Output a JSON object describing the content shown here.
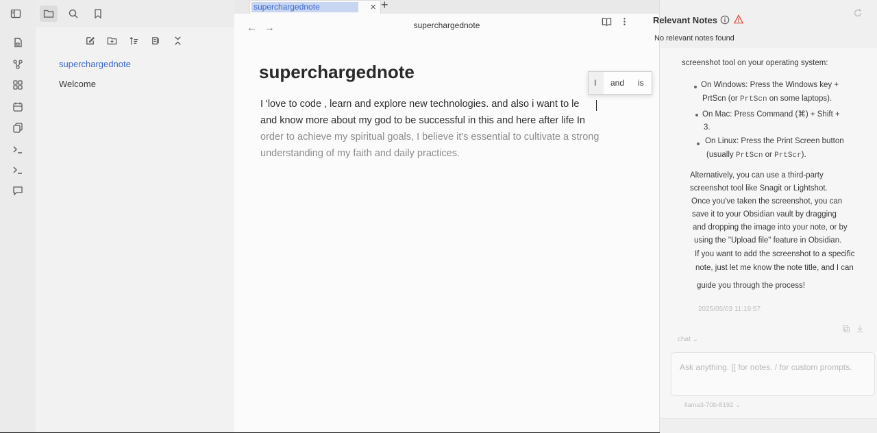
{
  "tab": {
    "title": "superchargednote",
    "close": "×",
    "new": "+"
  },
  "nav": {
    "back": "←",
    "forward": "→",
    "view_title": "superchargednote"
  },
  "files": [
    {
      "name": "superchargednote"
    },
    {
      "name": "Welcome"
    }
  ],
  "note": {
    "title": "superchargednote",
    "lines": [
      "I 'love to code , learn and explore new technologies.  and also i want to le",
      "and know more about my god to be successful in this and  here after life In",
      "order to achieve my spiritual goals, I believe it's essential to cultivate a strong",
      "understanding of my faith and daily practices."
    ]
  },
  "suggestions": [
    "I",
    "and",
    "is"
  ],
  "relevant": {
    "title": "Relevant Notes",
    "empty": "No relevant notes found"
  },
  "chat": {
    "intro": "screenshot tool on your operating system:",
    "b1a": "On Windows: Press the Windows key +",
    "b1b_pre": "PrtScn (or ",
    "b1b_code": "PrtScn",
    "b1b_post": " on some laptops).",
    "b2a": "On Mac: Press Command (⌘) + Shift +",
    "b2b": "3.",
    "b3a": "On Linux: Press the Print Screen button",
    "b3b_pre": "(usually ",
    "b3b_code1": "PrtScn",
    "b3b_mid": " or ",
    "b3b_code2": "PrtScr",
    "b3b_post": ").",
    "para": [
      "Alternatively, you can use a third-party",
      "screenshot tool like Snagit or Lightshot.",
      "Once you've taken the screenshot, you can",
      "save it to your Obsidian vault by dragging",
      "and dropping the image into your note, or by",
      "using the \"Upload file\" feature in Obsidian.",
      "If you want to add the screenshot to a specific",
      "note, just let me know the note title, and I can",
      "guide you through the process!"
    ],
    "timestamp": "2025/05/03 11:19:57",
    "mode": "chat",
    "placeholder": "Ask anything. [[ for notes. / for custom prompts.",
    "model": "llama3-70b-8192"
  },
  "colors": {
    "accent": "#3b68c9",
    "warning": "#e0453a"
  }
}
